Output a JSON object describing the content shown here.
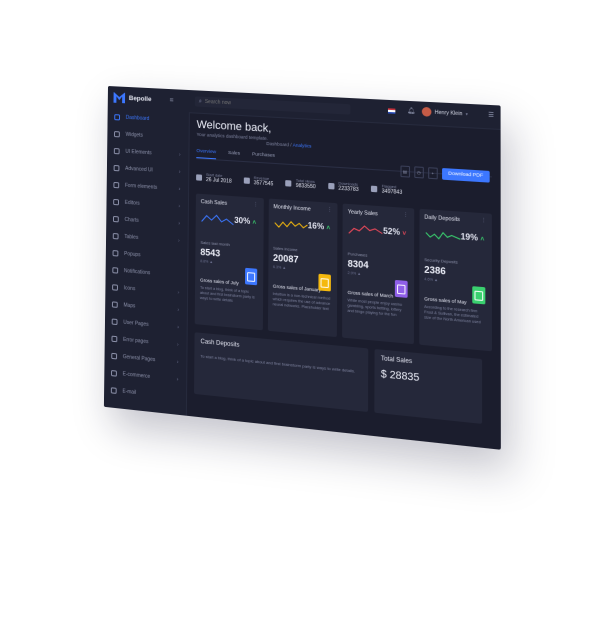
{
  "app": {
    "logo_text": "Bepolle"
  },
  "sidebar": {
    "items": [
      {
        "label": "Dashboard",
        "active": true,
        "chevron": false
      },
      {
        "label": "Widgets",
        "chevron": false
      },
      {
        "label": "UI Elements",
        "chevron": true
      },
      {
        "label": "Advanced UI",
        "chevron": true
      },
      {
        "label": "Form elements",
        "chevron": true
      },
      {
        "label": "Editors",
        "chevron": true
      },
      {
        "label": "Charts",
        "chevron": true
      },
      {
        "label": "Tables",
        "chevron": true
      },
      {
        "label": "Popups",
        "chevron": false
      },
      {
        "label": "Notifications",
        "chevron": false
      },
      {
        "label": "Icons",
        "chevron": true
      },
      {
        "label": "Maps",
        "chevron": true
      },
      {
        "label": "User Pages",
        "chevron": true
      },
      {
        "label": "Error pages",
        "chevron": true
      },
      {
        "label": "General Pages",
        "chevron": true
      },
      {
        "label": "E-commerce",
        "chevron": true
      },
      {
        "label": "E-mail",
        "chevron": false
      }
    ]
  },
  "topbar": {
    "search_placeholder": "Search now",
    "user_name": "Henry Klein"
  },
  "main": {
    "welcome": "Welcome back,",
    "subtitle": "Your analytics dashboard template.",
    "breadcrumb_home": "Dashboard",
    "breadcrumb_current": "Analytics",
    "tabs": [
      "Overview",
      "Sales",
      "Purchases"
    ],
    "primary_button": "Download PDF",
    "stats": [
      {
        "label": "Start date",
        "value": "26 Jul 2018"
      },
      {
        "label": "Revenue",
        "value": "3577545"
      },
      {
        "label": "Total views",
        "value": "9833550"
      },
      {
        "label": "Downloads",
        "value": "2233783"
      },
      {
        "label": "Flagged",
        "value": "3497843"
      }
    ],
    "cards": [
      {
        "title": "Cash Sales",
        "percent": "30%",
        "trend": "up",
        "line_color": "#3c77ff",
        "metric_label": "Sales last month",
        "metric_value": "8543",
        "metric_change": "8.8% ▲",
        "icon_color": "#3c77ff",
        "heading": "Gross sales of July",
        "text": "To start a blog, think of a topic about and first brainstorm party is ways to write details"
      },
      {
        "title": "Monthly Income",
        "percent": "16%",
        "trend": "up",
        "line_color": "#f5b90e",
        "metric_label": "Sales income",
        "metric_value": "20087",
        "metric_change": "6.3% ▲",
        "icon_color": "#f5b90e",
        "heading": "Gross sales of January",
        "text": "Intuition is a non-technical method which requires the use of advance neural networks. Placeholder text"
      },
      {
        "title": "Yearly Sales",
        "percent": "52%",
        "trend": "down",
        "line_color": "#ef4a5b",
        "metric_label": "Purchases",
        "metric_value": "8304",
        "metric_change": "2.9% ▲",
        "icon_color": "#8f5fe8",
        "heading": "Gross sales of March",
        "text": "While most people enjoy casino gambling, sports betting, lottery and bingo playing for the fun"
      },
      {
        "title": "Daily Deposits",
        "percent": "19%",
        "trend": "up",
        "line_color": "#3ad06f",
        "metric_label": "Security Deposits",
        "metric_value": "2386",
        "metric_change": "4.6% ▲",
        "icon_color": "#3ad06f",
        "heading": "Gross sales of May",
        "text": "According to the research firm Frost & Sullivan, the estimated size of the North American used"
      }
    ],
    "bottom_left": {
      "title": "Cash Deposits",
      "text": "To start a blog, think of a topic about and first brainstorm party is ways to write details."
    },
    "bottom_right": {
      "title": "Total Sales",
      "value": "$ 28835"
    }
  }
}
